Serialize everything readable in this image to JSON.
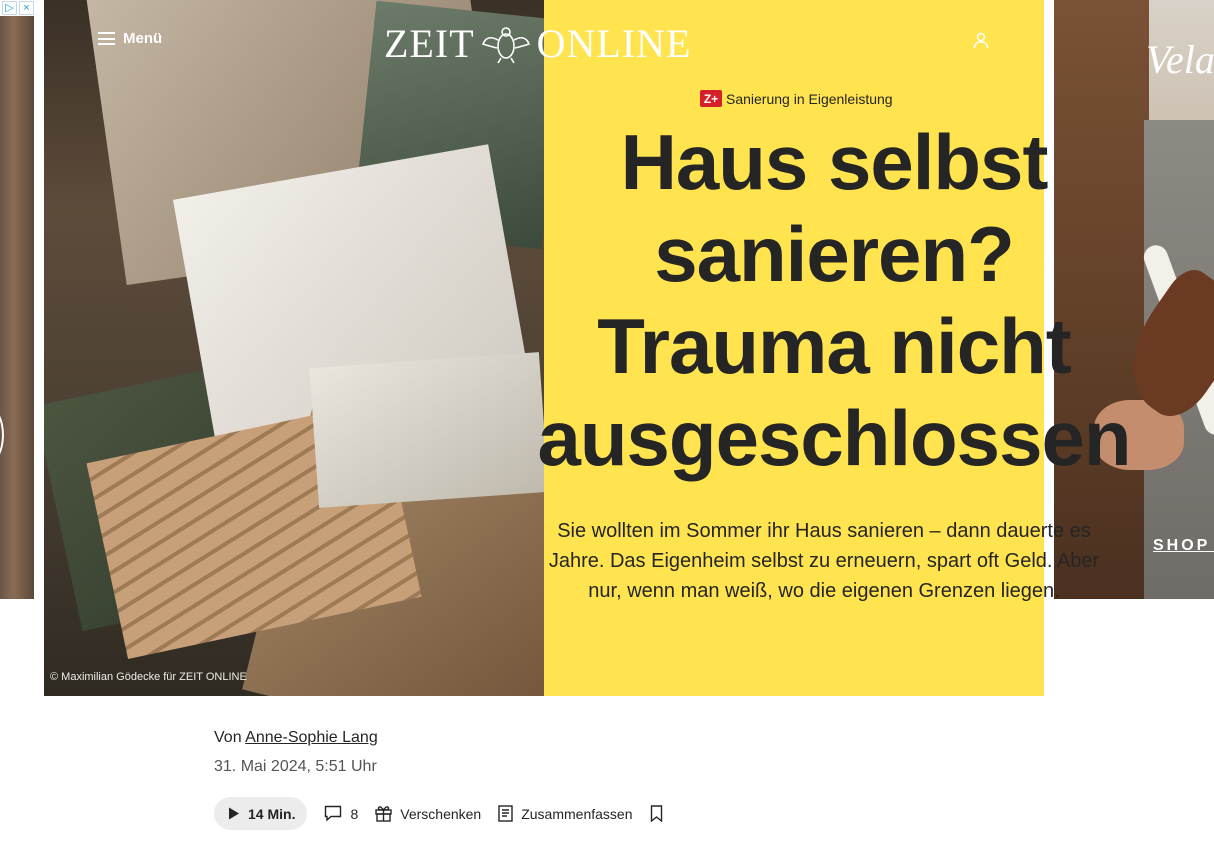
{
  "header": {
    "menu_label": "Menü",
    "logo_text_left": "ZEIT",
    "logo_text_right": "ONLINE"
  },
  "ads": {
    "left_badges": [
      "▷",
      "×"
    ],
    "right_brand": "Vela",
    "right_cta": "SHOP N"
  },
  "article": {
    "kicker_badge": "Z+",
    "kicker": "Sanierung in Eigenleistung",
    "headline": "Haus selbst sanieren? Trauma nicht ausgeschlossen",
    "summary": "Sie wollten im Sommer ihr Haus sanieren – dann dauerte es Jahre. Das Eigenheim selbst zu erneuern, spart oft Geld. Aber nur, wenn man weiß, wo die eigenen Grenzen liegen.",
    "image_credit": "© Maximilian Gödecke für ZEIT ONLINE",
    "byline_prefix": "Von",
    "author": "Anne-Sophie Lang",
    "date": "31. Mai 2024, 5:51 Uhr"
  },
  "actions": {
    "listen_duration": "14 Min.",
    "comments_count": "8",
    "gift_label": "Verschenken",
    "summarize_label": "Zusammenfassen"
  }
}
